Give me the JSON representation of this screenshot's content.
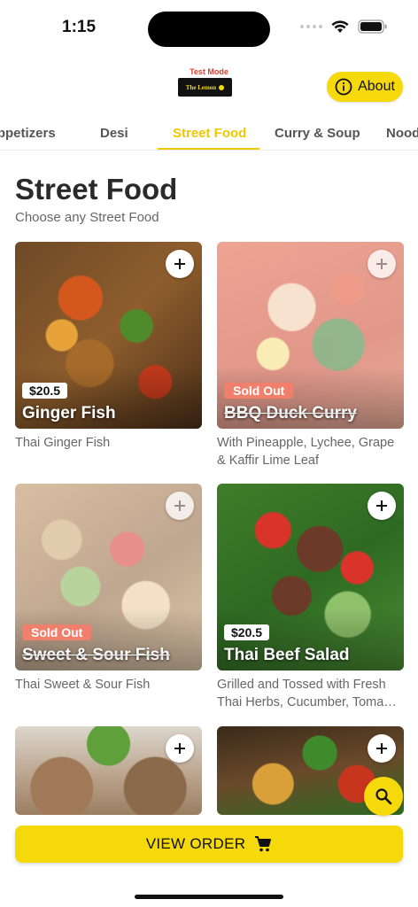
{
  "status": {
    "time": "1:15"
  },
  "header": {
    "test_mode": "Test Mode",
    "logo_text": "The Lemon",
    "about_label": "About"
  },
  "tabs": [
    {
      "label": "Appetizers"
    },
    {
      "label": "Desi"
    },
    {
      "label": "Street Food",
      "active": true
    },
    {
      "label": "Curry & Soup"
    },
    {
      "label": "Noodles"
    }
  ],
  "section": {
    "title": "Street Food",
    "subtitle": "Choose any Street Food"
  },
  "items": [
    {
      "name": "Ginger Fish",
      "price": "$20.5",
      "description": "Thai Ginger Fish"
    },
    {
      "name": "BBQ Duck Curry",
      "status": "Sold Out",
      "description": "With Pineapple, Lychee, Grape & Kaffir Lime Leaf"
    },
    {
      "name": "Sweet & Sour Fish",
      "status": "Sold Out",
      "description": "Thai Sweet & Sour Fish"
    },
    {
      "name": "Thai Beef Salad",
      "price": "$20.5",
      "description": "Grilled and Tossed with Fresh Thai Herbs, Cucumber, Toma…"
    }
  ],
  "footer": {
    "view_order_label": "VIEW ORDER"
  },
  "colors": {
    "accent": "#f5d90a",
    "sold_out": "#f0806c",
    "test_mode": "#d9412c"
  },
  "icons": [
    "wifi-icon",
    "battery-icon",
    "info-icon",
    "plus-icon",
    "search-icon",
    "cart-icon"
  ]
}
